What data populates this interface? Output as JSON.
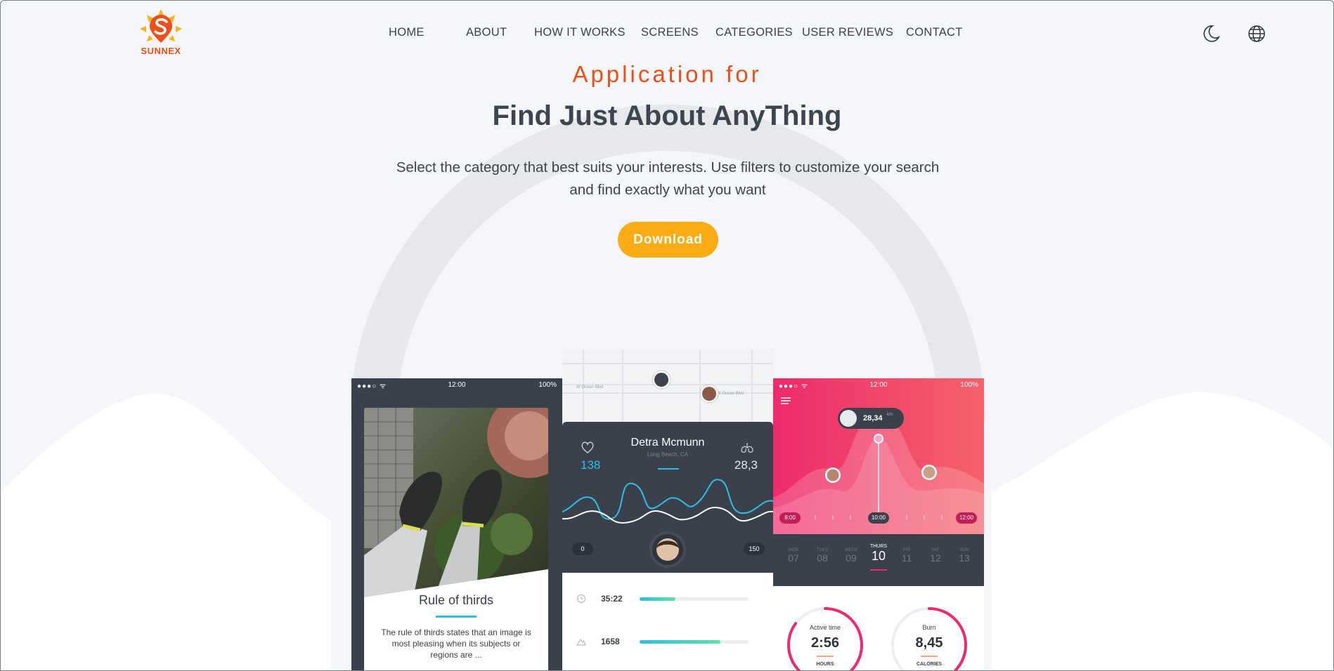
{
  "brand": {
    "name": "SUNNEX",
    "accent": "#ee4e17",
    "sun": "#fbb116"
  },
  "nav": {
    "items": [
      {
        "label": "HOME"
      },
      {
        "label": "ABOUT"
      },
      {
        "label": "HOW IT WORKS"
      },
      {
        "label": "SCREENS"
      },
      {
        "label": "CATEGORIES"
      },
      {
        "label": "USER REVIEWS"
      },
      {
        "label": "CONTACT"
      }
    ]
  },
  "header_icons": [
    "moon-icon",
    "globe-icon"
  ],
  "hero": {
    "pretitle": "Application for",
    "title": "Find Just About AnyThing",
    "description": "Select the category that best suits your interests. Use filters to customize your search and find exactly what you want",
    "download_label": "Download",
    "button_color": "#fbac14"
  },
  "phone_left": {
    "status_time": "12:00",
    "status_battery": "100%",
    "card_title": "Rule of thirds",
    "card_text": "The rule of thirds states that an image is most pleasing when its subjects or regions are ..."
  },
  "phone_middle": {
    "map_streets": [
      "W Ocean Blvd",
      "W Ocean Blvd"
    ],
    "user_name": "Detra Mcmunn",
    "user_location": "Long Beach, CA",
    "heart_value": "138",
    "lungs_value": "28,3",
    "range_min": "0",
    "range_max": "150",
    "stats": [
      {
        "value": "35:22",
        "progress": 0.33
      },
      {
        "value": "1658",
        "progress": 0.74
      }
    ]
  },
  "phone_right": {
    "status_time": "12:00",
    "status_battery": "100%",
    "peak_value": "28,34",
    "peak_unit": "km",
    "time_left": "8:00",
    "time_mid": "10:00",
    "time_right": "12:00",
    "days": [
      {
        "name": "MON",
        "num": "07"
      },
      {
        "name": "TUES",
        "num": "08"
      },
      {
        "name": "WEDS",
        "num": "09"
      },
      {
        "name": "THURS",
        "num": "10"
      },
      {
        "name": "FRI",
        "num": "11"
      },
      {
        "name": "SAT",
        "num": "12"
      },
      {
        "name": "SUN",
        "num": "13"
      }
    ],
    "gauges": [
      {
        "label": "Active time",
        "value": "2:56",
        "unit": "HOURS",
        "progress": 0.85
      },
      {
        "label": "Burn",
        "value": "8,45",
        "unit": "CALORIES",
        "progress": 0.6
      }
    ]
  }
}
